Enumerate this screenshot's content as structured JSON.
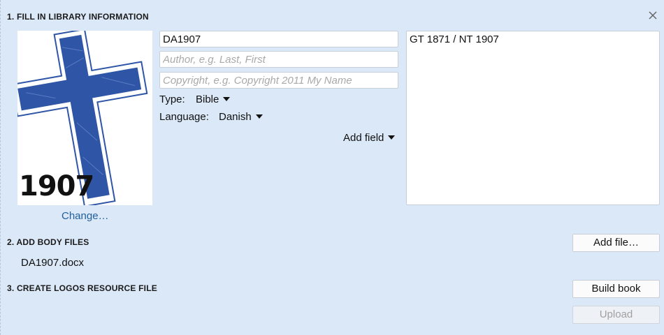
{
  "sections": {
    "fill_info": "1. FILL IN LIBRARY INFORMATION",
    "add_body": "2. ADD BODY FILES",
    "create_resource": "3. CREATE LOGOS RESOURCE FILE"
  },
  "cover": {
    "year_text": "1907",
    "change_link": "Change…"
  },
  "fields": {
    "title_value": "DA1907",
    "author_placeholder": "Author, e.g. Last, First",
    "copyright_placeholder": "Copyright, e.g. Copyright 2011 My Name",
    "type_label": "Type:",
    "type_value": "Bible",
    "language_label": "Language:",
    "language_value": "Danish",
    "add_field": "Add field",
    "description": "GT 1871 / NT 1907"
  },
  "body_files": {
    "items": [
      "DA1907.docx"
    ],
    "add_button": "Add file…"
  },
  "actions": {
    "build_button": "Build book",
    "upload_button": "Upload"
  },
  "icons": {
    "close": "close-icon",
    "cross_color": "#2f56a6"
  }
}
